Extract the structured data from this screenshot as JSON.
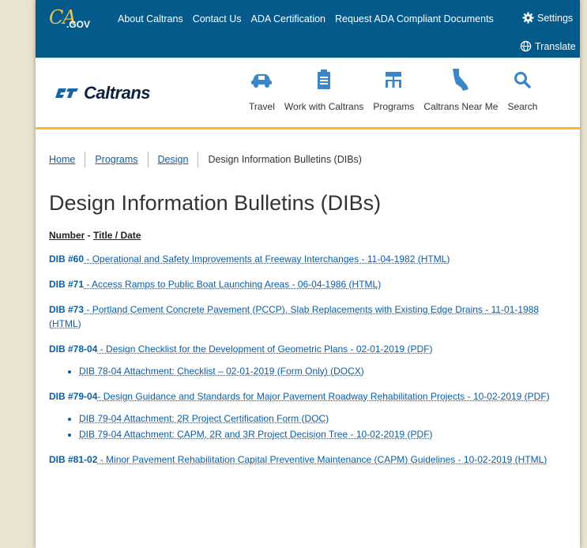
{
  "brand": {
    "ca": "CA",
    "gov": ".GOV",
    "logo_word": "Caltrans"
  },
  "colors": {
    "topbar": "#035a8b",
    "accent": "#fdb81e",
    "link": "#0b5ea8"
  },
  "topbar": {
    "links": [
      "About Caltrans",
      "Contact Us",
      "ADA Certification",
      "Request ADA Compliant Documents"
    ],
    "settings": "Settings",
    "translate": "Translate"
  },
  "nav": [
    {
      "label": "Travel",
      "icon": "car-icon"
    },
    {
      "label": "Work with Caltrans",
      "icon": "document-icon"
    },
    {
      "label": "Programs",
      "icon": "sitemap-icon"
    },
    {
      "label": "Caltrans Near Me",
      "icon": "california-map-icon"
    },
    {
      "label": "Search",
      "icon": "search-icon"
    }
  ],
  "breadcrumb": [
    "Home",
    "Programs",
    "Design",
    "Design Information Bulletins (DIBs)"
  ],
  "page_title": "Design Information Bulletins (DIBs)",
  "column_header": {
    "number": "Number",
    "sep": " - ",
    "title": "Title / Date"
  },
  "entries": [
    {
      "num": "DIB #60",
      "text": " - Operational and Safety Improvements at Freeway Interchanges - 11-04-1982 (HTML)",
      "subs": []
    },
    {
      "num": "DIB #71",
      "text": " - Access Ramps to Public Boat Launching Areas - 06-04-1986 (HTML)",
      "subs": []
    },
    {
      "num": "DIB #73",
      "text": " - Portland Cement Concrete Pavement (PCCP). Slab Replacements with Existing Edge Drains - 11-01-1988 (HTML)",
      "subs": []
    },
    {
      "num": "DIB #78-04",
      "text": " - Design Checklist for the Development of Geometric Plans - 02-01-2019 (PDF)",
      "subs": [
        "DIB 78-04 Attachment: Checklist – 02-01-2019 (Form Only) (DOCX)"
      ]
    },
    {
      "num": "DIB #79-04",
      "text": "- Design Guidance and Standards for Major Pavement Roadway Rehabilitation Projects - 10-02-2019 (PDF)",
      "subs": [
        "DIB 79-04 Attachment: 2R Project Certification Form (DOC)",
        "DIB 79-04 Attachment: CAPM, 2R and 3R Project Decision Tree - 10-02-2019 (PDF)"
      ]
    },
    {
      "num": "DIB #81-02",
      "text": " - Minor Pavement Rehabilitation Capital Preventive Maintenance (CAPM) Guidelines - 10-02-2019 (HTML)",
      "subs": []
    }
  ]
}
